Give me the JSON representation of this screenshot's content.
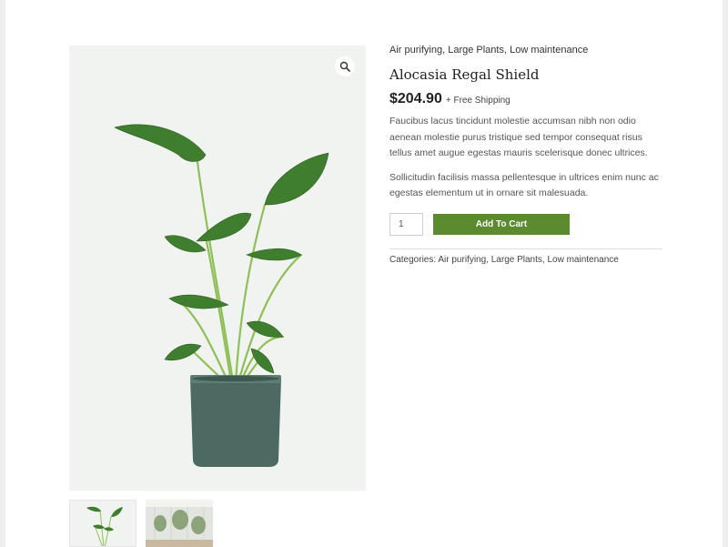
{
  "product": {
    "tags": [
      "Air purifying",
      "Large Plants",
      "Low maintenance"
    ],
    "title": "Alocasia Regal Shield",
    "price": "$204.90",
    "shipping": "+ Free Shipping",
    "description_1": "Faucibus lacus tincidunt molestie accumsan nibh non odio aenean molestie purus tristique sed tempor consequat risus tellus amet augue egestas mauris scelerisque donec ultrices.",
    "description_2": "Sollicitudin facilisis massa pellentesque in ultrices enim nunc ac egestas elementum ut in ornare sit malesuada.",
    "quantity": "1",
    "add_to_cart_label": "Add To Cart",
    "categories_label": "Categories:",
    "categories": [
      "Air purifying",
      "Large Plants",
      "Low maintenance"
    ]
  },
  "gallery": {
    "zoom_icon": "magnifier-icon",
    "thumbnail_count": 2
  },
  "colors": {
    "accent": "#5b8a2f",
    "pot": "#4d6a62",
    "leaf": "#3c7a2e"
  }
}
